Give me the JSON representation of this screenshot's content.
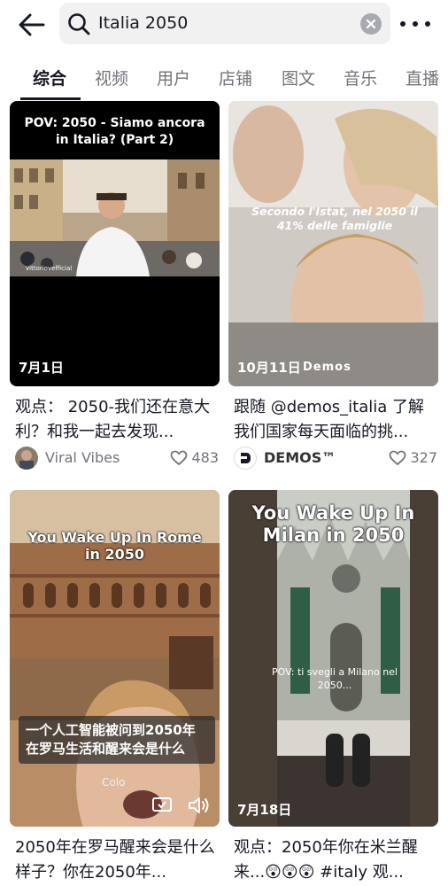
{
  "search": {
    "query": "Italia 2050"
  },
  "tabs": [
    {
      "label": "综合"
    },
    {
      "label": "视频"
    },
    {
      "label": "用户"
    },
    {
      "label": "店铺"
    },
    {
      "label": "图文"
    },
    {
      "label": "音乐"
    },
    {
      "label": "直播"
    }
  ],
  "cards": [
    {
      "overlay": "POV: 2050 - Siamo ancora in Italia? (Part 2)",
      "watermark": "vittoriovefficial",
      "date": "7月1日",
      "title": "观点： 2050-我们还在意大利？和我一起去发现...",
      "author": "Viral Vibes",
      "likes": "483"
    },
    {
      "overlay": "Secondo l'Istat, nel 2050 il 41% delle famiglie",
      "date": "10月11日",
      "brand": "Demos",
      "title": "跟随 @demos_italia 了解我们国家每天面临的挑...",
      "author": "DEMOS™",
      "likes": "327"
    },
    {
      "overlay": "You Wake Up In Rome in 2050",
      "caption": "一个人工智能被问到2050年在罗马生活和醒来会是什么",
      "caption_faint": "Colo",
      "title": "2050年在罗马醒来会是什么样子？你在2050年..."
    },
    {
      "overlay": "You Wake Up In Milan in 2050",
      "overlay2": "POV: ti svegli a Milano nel 2050...",
      "date": "7月18日",
      "title": "观点：2050年你在米兰醒来...😲😲😲 #italy 观..."
    }
  ],
  "colors": {
    "text": "#161823",
    "muted": "#73747b",
    "search_bg": "#f1f1f2"
  }
}
